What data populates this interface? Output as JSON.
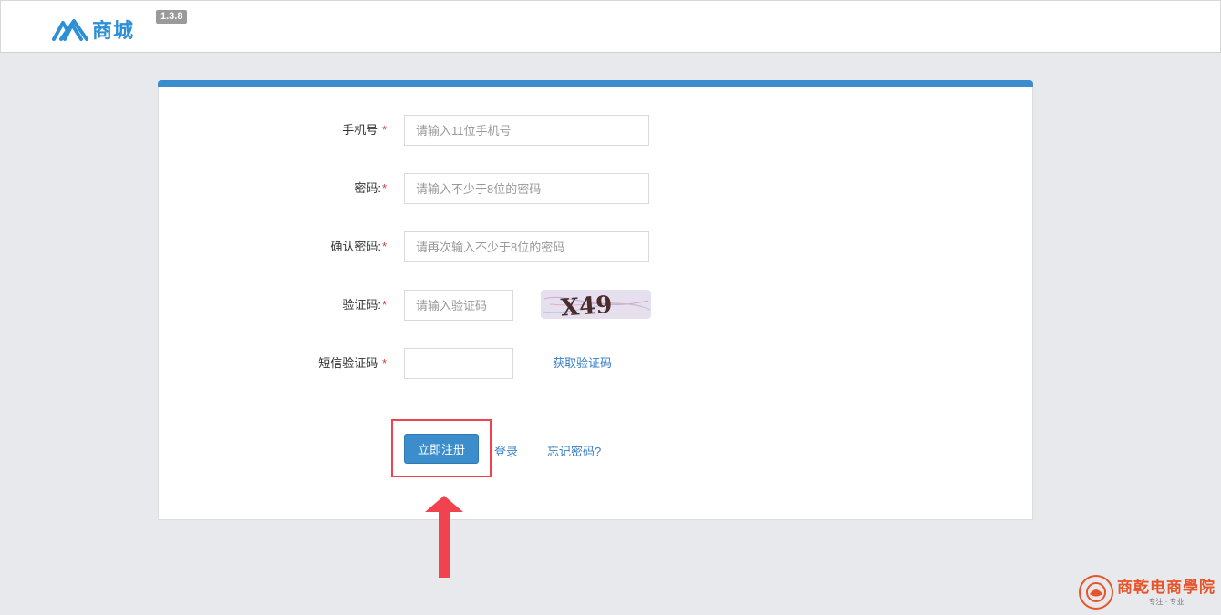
{
  "header": {
    "logo_text": "商城",
    "version": "1.3.8"
  },
  "form": {
    "phone": {
      "label": "手机号",
      "required_mark": "*",
      "placeholder": "请输入11位手机号",
      "value": ""
    },
    "password": {
      "label": "密码:",
      "required_mark": "*",
      "placeholder": "请输入不少于8位的密码",
      "value": ""
    },
    "confirm_password": {
      "label": "确认密码:",
      "required_mark": "*",
      "placeholder": "请再次输入不少于8位的密码",
      "value": ""
    },
    "captcha": {
      "label": "验证码:",
      "required_mark": "*",
      "placeholder": "请输入验证码",
      "value": "",
      "image_text": "X49"
    },
    "sms_code": {
      "label": "短信验证码",
      "required_mark": "*",
      "placeholder": "",
      "value": "",
      "get_code_label": "获取验证码"
    },
    "submit_label": "立即注册",
    "login_label": "登录",
    "forgot_label": "忘记密码?"
  },
  "annotation": {
    "highlight_color": "#f0424f"
  },
  "watermark": {
    "title": "商乾电商學院",
    "subtitle": "专注 · 专业"
  },
  "colors": {
    "accent": "#3c8dcc",
    "link": "#3b7fc4",
    "required": "#e4393c",
    "background": "#e8e9ec"
  }
}
